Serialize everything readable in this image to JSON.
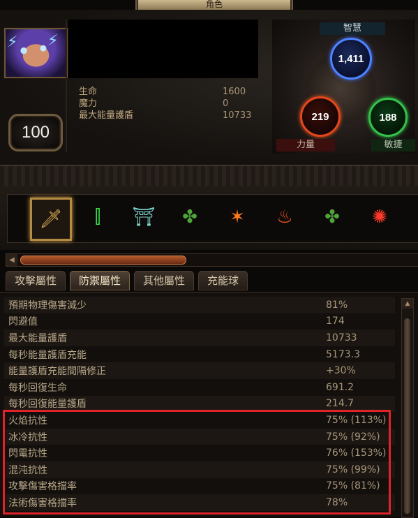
{
  "window": {
    "title": "角色"
  },
  "character": {
    "level": "100",
    "stats": [
      {
        "label": "生命",
        "value": "1600"
      },
      {
        "label": "魔力",
        "value": "0"
      },
      {
        "label": "最大能量護盾",
        "value": "10733"
      }
    ]
  },
  "attributes": {
    "intelligence": {
      "label": "智慧",
      "value": "1,411",
      "color": "#4f84ff"
    },
    "strength": {
      "label": "力量",
      "value": "219",
      "color": "#e4471e"
    },
    "dexterity": {
      "label": "敏捷",
      "value": "188",
      "color": "#35c24a"
    }
  },
  "skills": [
    {
      "icon": "sword-icon",
      "active": true
    },
    {
      "icon": "green-spikes-icon",
      "active": false
    },
    {
      "icon": "totem-icon",
      "active": false
    },
    {
      "icon": "green-armour-icon",
      "active": false
    },
    {
      "icon": "fire-slash-icon",
      "active": false
    },
    {
      "icon": "burning-figure-icon",
      "active": false
    },
    {
      "icon": "green-armour-icon",
      "active": false
    },
    {
      "icon": "fire-rune-icon",
      "active": false
    }
  ],
  "tabs": [
    {
      "label": "攻擊屬性",
      "active": false
    },
    {
      "label": "防禦屬性",
      "active": true
    },
    {
      "label": "其他屬性",
      "active": false
    },
    {
      "label": "充能球",
      "active": false
    }
  ],
  "defence_stats": [
    {
      "name": "預期物理傷害減少",
      "value": "81%"
    },
    {
      "name": "閃避值",
      "value": "174"
    },
    {
      "name": "最大能量護盾",
      "value": "10733"
    },
    {
      "name": "每秒能量護盾充能",
      "value": "5173.3"
    },
    {
      "name": "能量護盾充能間隔修正",
      "value": "+30%"
    },
    {
      "name": "每秒回復生命",
      "value": "691.2"
    },
    {
      "name": "每秒回復能量護盾",
      "value": "214.7"
    },
    {
      "name": "火焰抗性",
      "value": "75% (113%)"
    },
    {
      "name": "冰冷抗性",
      "value": "75% (92%)"
    },
    {
      "name": "閃電抗性",
      "value": "76% (153%)"
    },
    {
      "name": "混沌抗性",
      "value": "75% (99%)"
    },
    {
      "name": "攻擊傷害格擋率",
      "value": "75% (81%)"
    },
    {
      "name": "法術傷害格擋率",
      "value": "78%"
    }
  ],
  "highlight_color": "#e0232a"
}
